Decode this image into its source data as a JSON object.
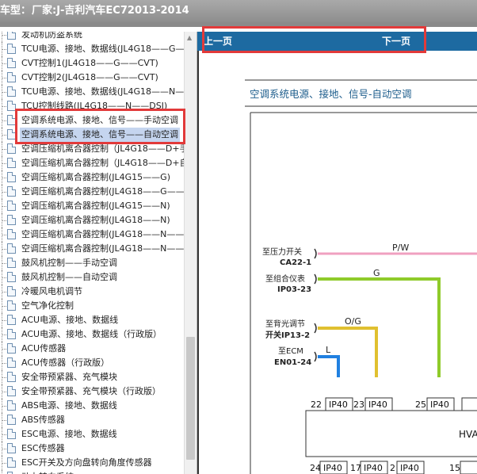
{
  "title": {
    "prefix": "车型：",
    "maker": "厂家:J-吉利汽车EC72013-2014"
  },
  "nav": {
    "prev_label": "上一页",
    "next_label": "下一页"
  },
  "tree": {
    "items": [
      {
        "label": "发动机防盗系统"
      },
      {
        "label": "TCU电源、接地、数据线(JL4G18——G—"
      },
      {
        "label": "CVT控制1(JL4G18——G——CVT)"
      },
      {
        "label": "CVT控制2(JL4G18——G——CVT)"
      },
      {
        "label": "TCU电源、接地、数据线(JL4G18——N—"
      },
      {
        "label": "TCU控制线路(JL4G18——N——DSI)"
      },
      {
        "label": "空调系统电源、接地、信号——手动空调"
      },
      {
        "label": "空调系统电源、接地、信号——自动空调"
      },
      {
        "label": "空调压缩机离合器控制（JL4G18——D+手"
      },
      {
        "label": "空调压缩机离合器控制（JL4G18——D+自"
      },
      {
        "label": "空调压缩机离合器控制(JL4G15——G)"
      },
      {
        "label": "空调压缩机离合器控制(JL4G18——G——"
      },
      {
        "label": "空调压缩机离合器控制(JL4G15——N)"
      },
      {
        "label": "空调压缩机离合器控制(JL4G18——N)"
      },
      {
        "label": "空调压缩机离合器控制(JL4G18——N——"
      },
      {
        "label": "空调压缩机离合器控制(JL4G18——N——"
      },
      {
        "label": "鼓风机控制——手动空调"
      },
      {
        "label": "鼓风机控制——自动空调"
      },
      {
        "label": "冷暖风电机调节"
      },
      {
        "label": "空气净化控制"
      },
      {
        "label": "ACU电源、接地、数据线"
      },
      {
        "label": "ACU电源、接地、数据线（行政版）"
      },
      {
        "label": "ACU传感器"
      },
      {
        "label": "ACU传感器（行政版）"
      },
      {
        "label": "安全带预紧器、充气模块"
      },
      {
        "label": "安全带预紧器、充气模块（行政版）"
      },
      {
        "label": "ABS电源、接地、数据线"
      },
      {
        "label": "ABS传感器"
      },
      {
        "label": "ESC电源、接地、数据线"
      },
      {
        "label": "ESC传感器"
      },
      {
        "label": "ESC开关及方向盘转向角度传感器"
      },
      {
        "label": "动力转向系统"
      }
    ]
  },
  "diagram": {
    "title": "空调系统电源、接地、信号-自动空调",
    "wires": [
      {
        "dest": "至压力开关",
        "conn": "CA22-1",
        "color_label": "P/W",
        "pin": "22",
        "hex": "#f0a0c0"
      },
      {
        "dest": "至组合仪表",
        "conn": "IP03-23",
        "color_label": "G",
        "pin": "23",
        "hex": "#8fcb2a"
      },
      {
        "dest": "至背光调节\n开关",
        "conn": "IP13-2",
        "color_label": "O/G",
        "pin": "25",
        "hex": "#e0c030"
      },
      {
        "dest": "至ECM",
        "conn": "EN01-24",
        "color_label": "L",
        "pin": "",
        "hex": "#2080e0"
      }
    ],
    "module_label": "HVA",
    "connector": "IP40",
    "bottom_pins": [
      "24",
      "17",
      "2",
      "15"
    ]
  },
  "colors": {
    "titlebar": "#9a9a9a",
    "navbar": "#1d6aa1",
    "highlight": "#e23a3a",
    "selection": "#c5d5ef"
  }
}
